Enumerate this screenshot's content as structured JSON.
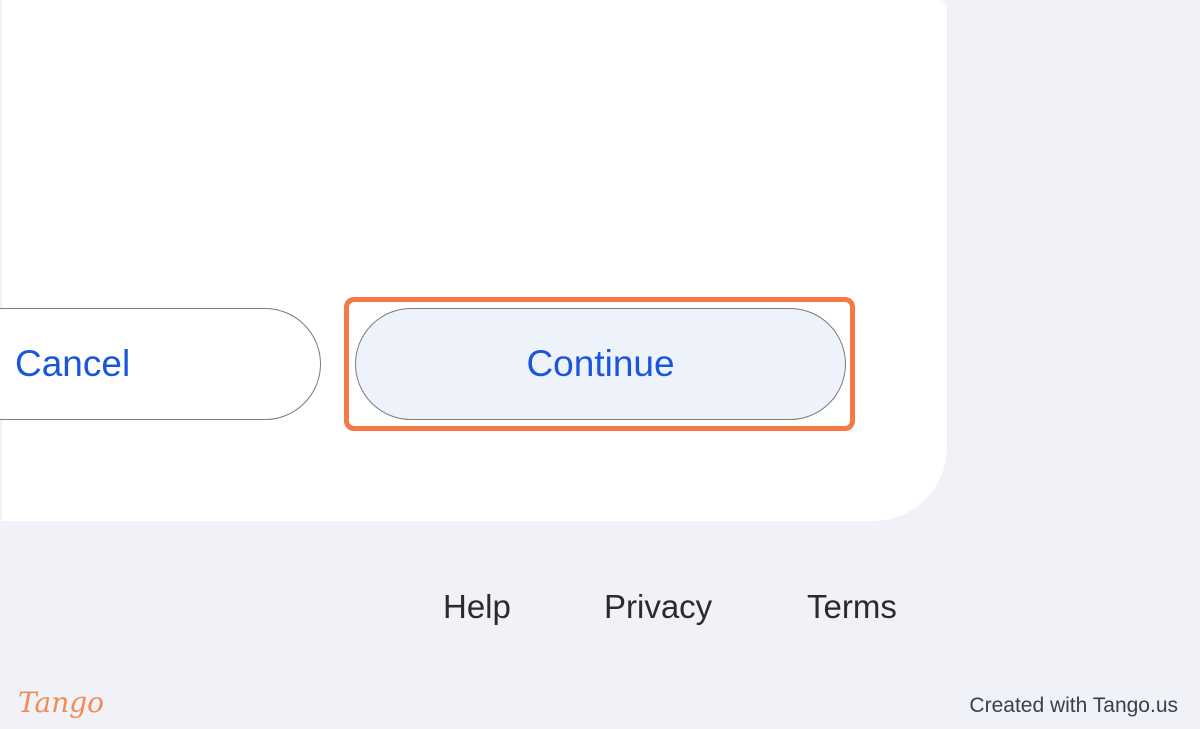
{
  "dialog": {
    "cancel_label": "Cancel",
    "continue_label": "Continue"
  },
  "footer": {
    "links": [
      "Help",
      "Privacy",
      "Terms"
    ]
  },
  "watermark": {
    "logo_text": "Tango",
    "credit_text": "Created with Tango.us"
  },
  "colors": {
    "page_background": "#f0f2f7",
    "card_background": "#ffffff",
    "button_text": "#1a56db",
    "continue_fill": "#edf2fb",
    "highlight_border": "#f47a45",
    "logo": "#f28b57"
  }
}
